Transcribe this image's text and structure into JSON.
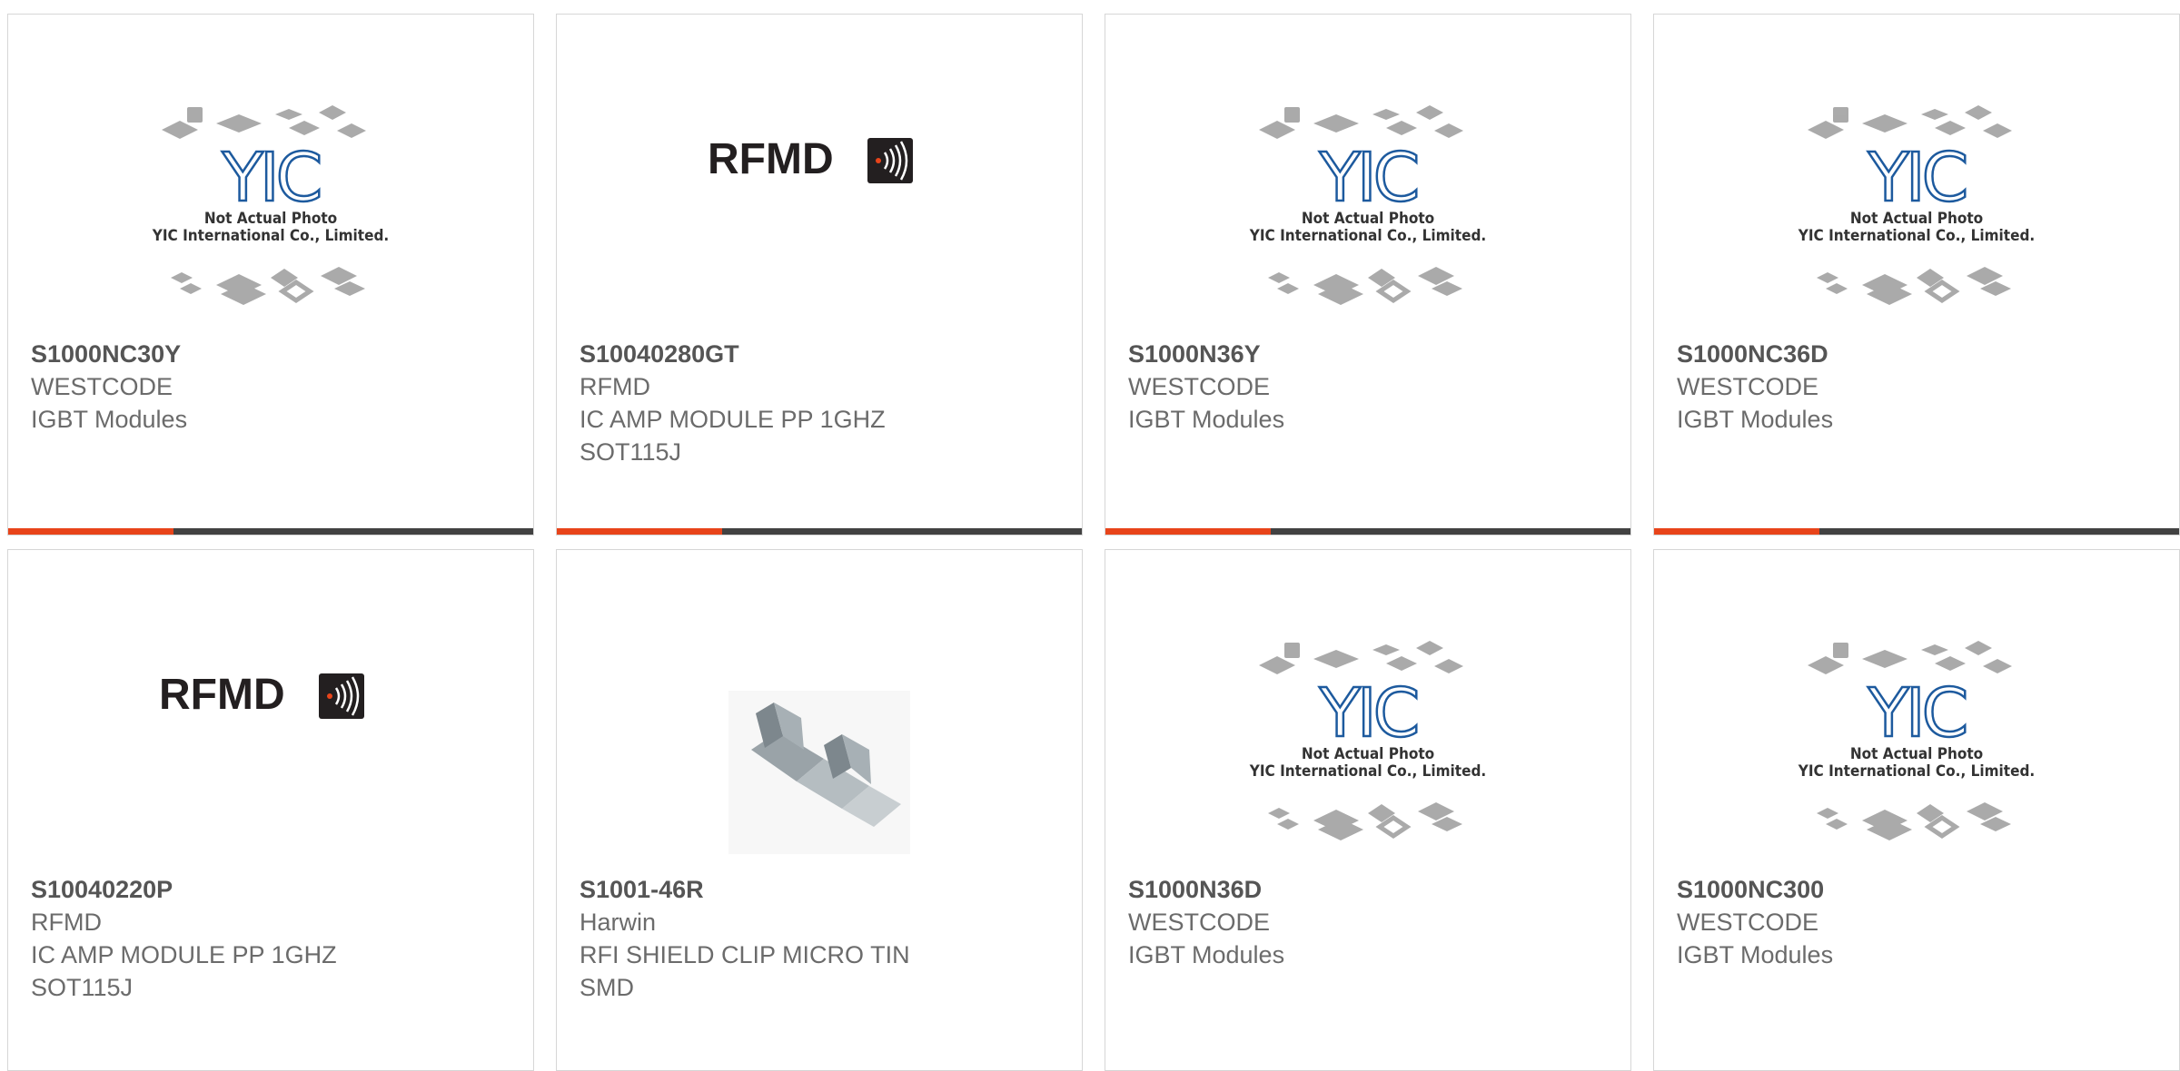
{
  "products": [
    {
      "part_number": "S1000NC30Y",
      "manufacturer": "WESTCODE",
      "description": "IGBT Modules",
      "image": "yic-placeholder-icon"
    },
    {
      "part_number": "S10040280GT",
      "manufacturer": "RFMD",
      "description": "IC AMP MODULE PP 1GHZ SOT115J",
      "image": "rfmd-logo-icon"
    },
    {
      "part_number": "S1000N36Y",
      "manufacturer": "WESTCODE",
      "description": "IGBT Modules",
      "image": "yic-placeholder-icon"
    },
    {
      "part_number": "S1000NC36D",
      "manufacturer": "WESTCODE",
      "description": "IGBT Modules",
      "image": "yic-placeholder-icon"
    },
    {
      "part_number": "S10040220P",
      "manufacturer": "RFMD",
      "description": "IC AMP MODULE PP 1GHZ SOT115J",
      "image": "rfmd-logo-icon"
    },
    {
      "part_number": "S1001-46R",
      "manufacturer": "Harwin",
      "description": "RFI SHIELD CLIP MICRO TIN SMD",
      "image": "shield-clip-photo-icon"
    },
    {
      "part_number": "S1000N36D",
      "manufacturer": "WESTCODE",
      "description": "IGBT Modules",
      "image": "yic-placeholder-icon"
    },
    {
      "part_number": "S1000NC300",
      "manufacturer": "WESTCODE",
      "description": "IGBT Modules",
      "image": "yic-placeholder-icon"
    }
  ],
  "placeholder": {
    "line1": "Not Actual Photo",
    "line2": "YIC International Co., Limited.",
    "logo": "YIC"
  },
  "rfmd_logo_text": "RFMD",
  "colors": {
    "accent": "#e8441a",
    "bar": "#424242",
    "border": "#d6d6d6",
    "text": "#6b6b6b"
  }
}
